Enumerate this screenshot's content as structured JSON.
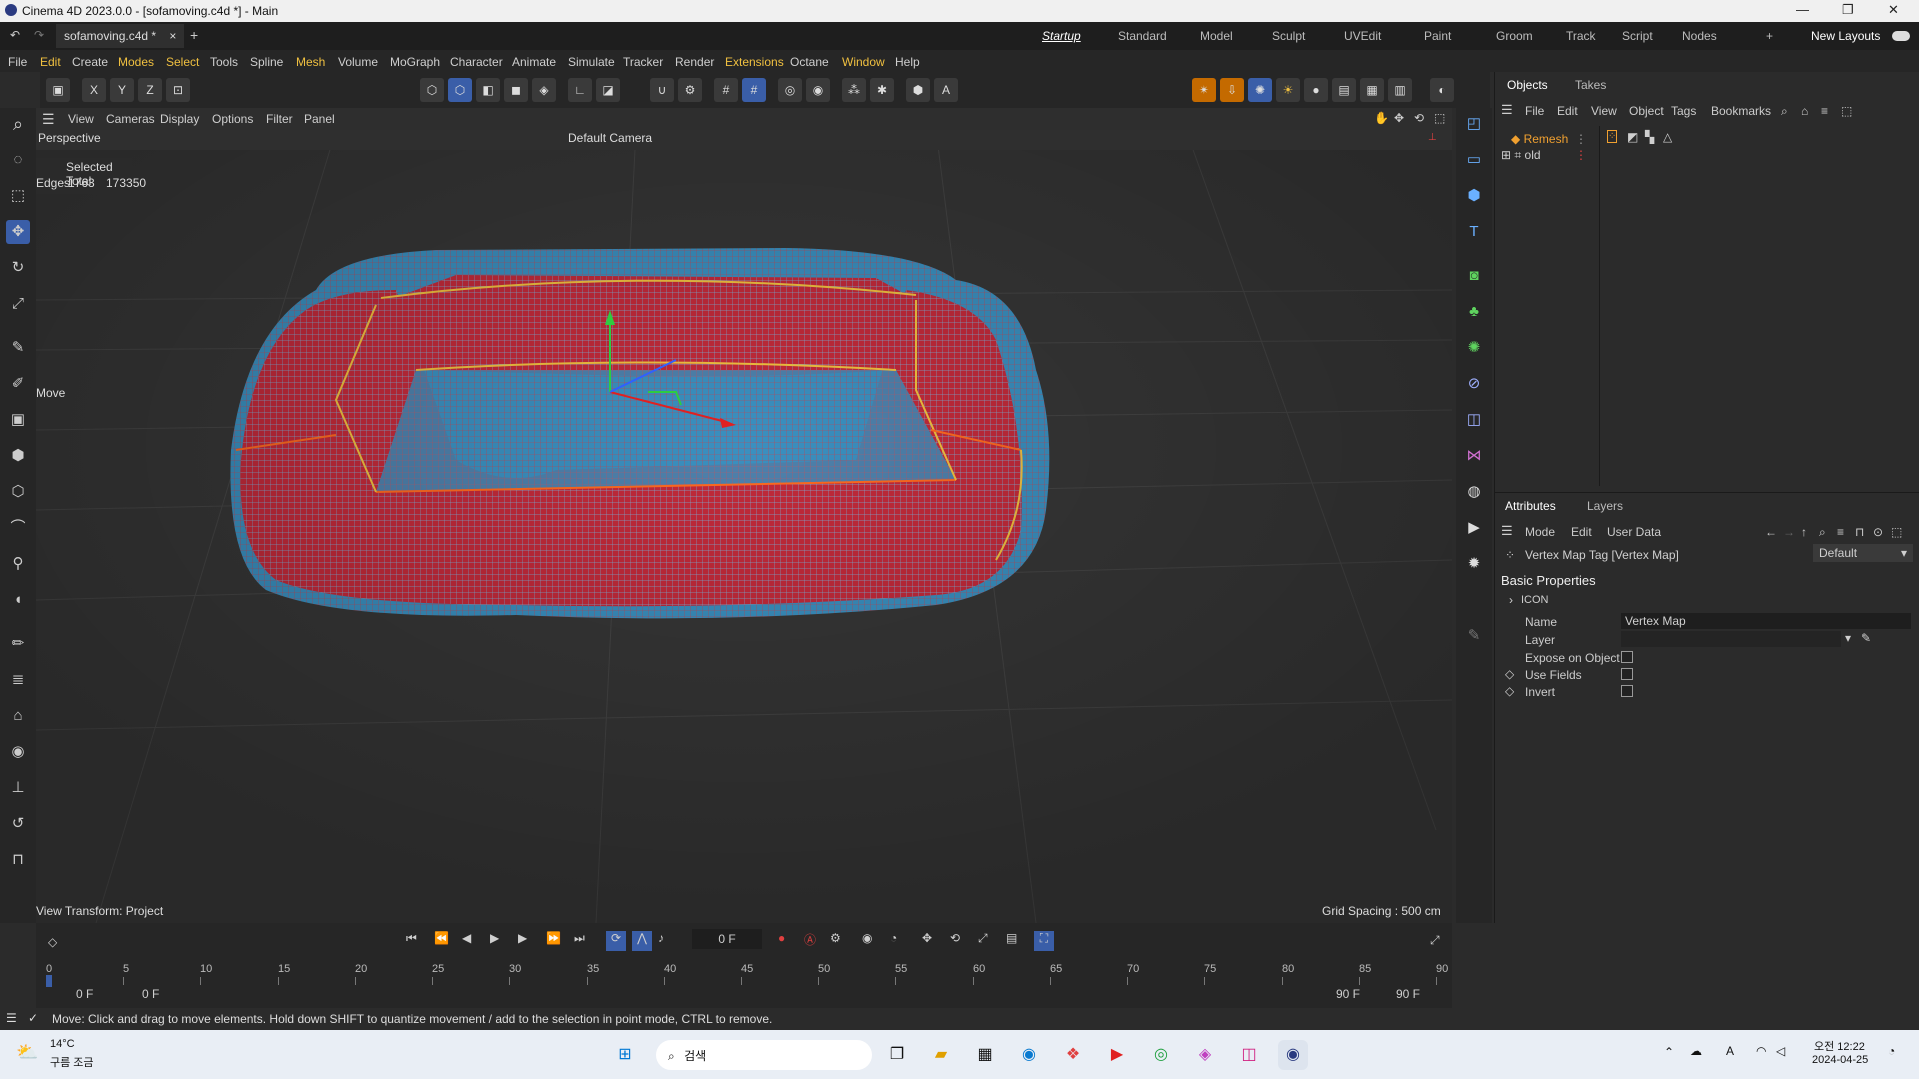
{
  "window": {
    "title": "Cinema 4D 2023.0.0 - [sofamoving.c4d *] - Main",
    "min": "—",
    "max": "❐",
    "close": "✕"
  },
  "tabs": {
    "doc": "sofamoving.c4d *",
    "close": "×",
    "add": "+"
  },
  "layouts": [
    "Startup",
    "Standard",
    "Model",
    "Sculpt",
    "UVEdit",
    "Paint",
    "Groom",
    "Track",
    "Script",
    "Nodes"
  ],
  "layout_add": "+",
  "new_layouts": "New Layouts",
  "menu": [
    "File",
    "Edit",
    "Create",
    "Modes",
    "Select",
    "Tools",
    "Spline",
    "Mesh",
    "Volume",
    "MoGraph",
    "Character",
    "Animate",
    "Simulate",
    "Tracker",
    "Render",
    "Extensions",
    "Octane",
    "Window",
    "Help"
  ],
  "viewport": {
    "menu": [
      "View",
      "Cameras",
      "Display",
      "Options",
      "Filter",
      "Panel"
    ],
    "label": "Perspective",
    "camera": "Default Camera",
    "selected_total": "Selected Total",
    "edges_label": "Edges",
    "edges_a": "1763",
    "edges_b": "173350",
    "move": "Move",
    "view_transform": "View Transform: Project",
    "grid_spacing": "Grid Spacing : 500 cm"
  },
  "objects": {
    "tabs": [
      "Objects",
      "Takes"
    ],
    "menu": [
      "File",
      "Edit",
      "View",
      "Object",
      "Tags",
      "Bookmarks"
    ],
    "items": [
      {
        "name": "Remesh",
        "color": "#f0a030"
      },
      {
        "name": "old",
        "color": "#cfcfcf"
      }
    ]
  },
  "attributes": {
    "tabs": [
      "Attributes",
      "Layers"
    ],
    "menu": [
      "Mode",
      "Edit",
      "User Data"
    ],
    "tag_title": "Vertex Map Tag [Vertex Map]",
    "preset": "Default",
    "section": "Basic Properties",
    "group": "ICON",
    "fields": [
      {
        "label": "Name",
        "value": "Vertex Map"
      },
      {
        "label": "Layer",
        "value": ""
      }
    ],
    "checks": [
      "Expose on Object",
      "Use Fields",
      "Invert"
    ]
  },
  "timeline": {
    "frame": "0 F",
    "ticks": [
      "0",
      "5",
      "10",
      "15",
      "20",
      "25",
      "30",
      "35",
      "40",
      "45",
      "50",
      "55",
      "60",
      "65",
      "70",
      "75",
      "80",
      "85",
      "90"
    ],
    "start_a": "0 F",
    "start_b": "0 F",
    "end_a": "90 F",
    "end_b": "90 F"
  },
  "status": "Move: Click and drag to move elements. Hold down SHIFT to quantize movement / add to the selection in point mode, CTRL to remove.",
  "taskbar": {
    "weather_temp": "14°C",
    "weather_desc": "구름 조금",
    "search": "검색",
    "time": "오전 12:22",
    "date": "2024-04-25"
  },
  "colors": {
    "accent": "#3a5ea8",
    "highlight": "#f0c040",
    "mesh_red": "#d8303a",
    "mesh_blue": "#3a8fc0"
  }
}
